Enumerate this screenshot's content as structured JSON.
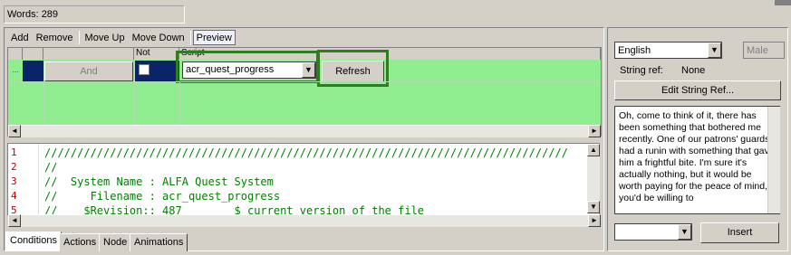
{
  "status": {
    "word_count": "Words: 289"
  },
  "toolbar": {
    "add": "Add",
    "remove": "Remove",
    "move_up": "Move Up",
    "move_down": "Move Down",
    "preview": "Preview"
  },
  "grid": {
    "headers": {
      "not": "Not",
      "script": "Script"
    },
    "row": {
      "selector": "...",
      "operator": "And",
      "not_checked": false,
      "script": "acr_quest_progress"
    },
    "refresh": "Refresh"
  },
  "code": {
    "lines": [
      {
        "no": "1",
        "text": "////////////////////////////////////////////////////////////////////////////////"
      },
      {
        "no": "2",
        "text": "//"
      },
      {
        "no": "3",
        "text": "//  System Name : ALFA Quest System"
      },
      {
        "no": "4",
        "text": "//     Filename : acr_quest_progress"
      },
      {
        "no": "5",
        "text": "//    $Revision:: 487        $ current version of the file"
      }
    ]
  },
  "tabs": [
    "Conditions",
    "Actions",
    "Node",
    "Animations"
  ],
  "right_panel": {
    "language": "English",
    "gender": "Male",
    "string_ref_label": "String ref:",
    "string_ref_value": "None",
    "edit_string_ref": "Edit String Ref...",
    "text": "Oh, come to think of it, there has been something that bothered me recently. One of our patrons' guards had a runin with something that gave him a frightful bite. I'm sure it's actually nothing, but it would be worth paying for the peace of mind, if you'd be willing to",
    "insert": "Insert"
  },
  "icons": {
    "dropdown": "▼",
    "scroll_left": "◄",
    "scroll_right": "►",
    "scroll_up": "▲",
    "scroll_down": "▼"
  },
  "colors": {
    "grid_bg": "#90ee90",
    "selected_cell": "#0a246a",
    "highlight_box": "#2e7d1e",
    "line_number": "#c00000",
    "comment": "#008000"
  }
}
